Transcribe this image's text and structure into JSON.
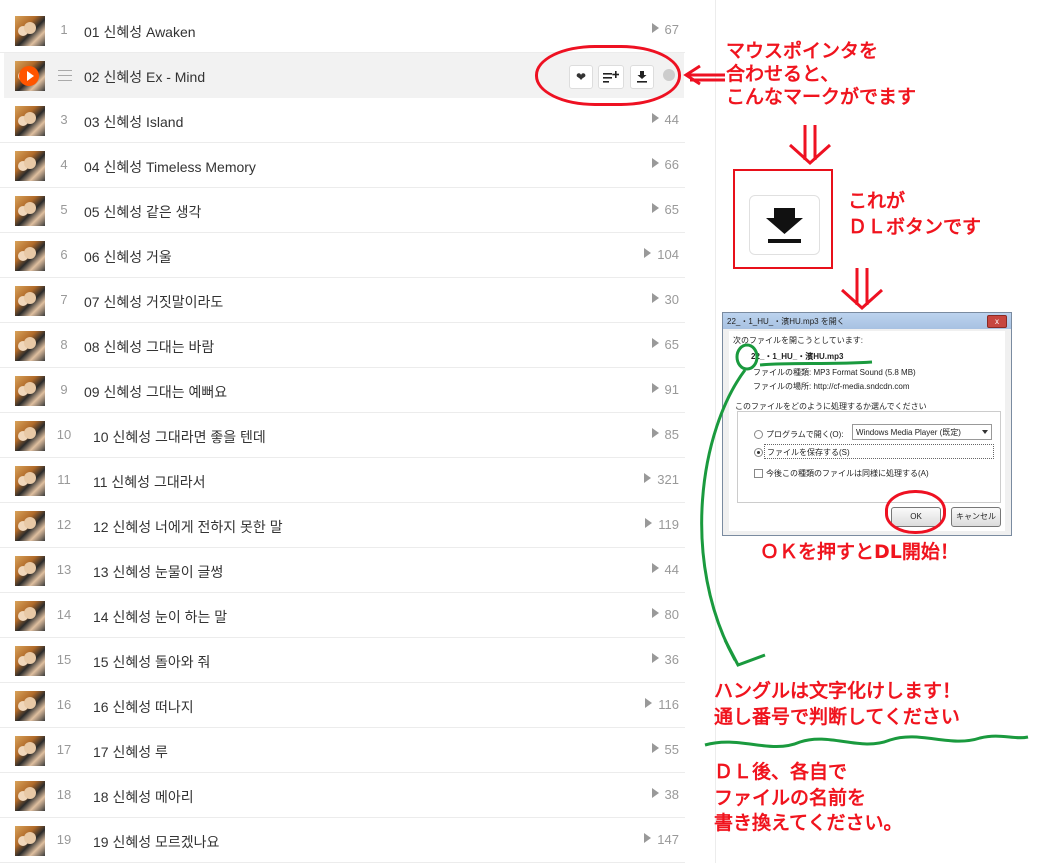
{
  "tracks": [
    {
      "num": "1",
      "title": "01 신혜성 Awaken",
      "plays": "67"
    },
    {
      "num": "",
      "title": "02 신혜성 Ex - Mind",
      "plays": ""
    },
    {
      "num": "3",
      "title": "03 신혜성 Island",
      "plays": "44"
    },
    {
      "num": "4",
      "title": "04 신혜성 Timeless Memory",
      "plays": "66"
    },
    {
      "num": "5",
      "title": "05 신혜성 같은 생각",
      "plays": "65"
    },
    {
      "num": "6",
      "title": "06 신혜성 거울",
      "plays": "104"
    },
    {
      "num": "7",
      "title": "07 신혜성 거짓말이라도",
      "plays": "30"
    },
    {
      "num": "8",
      "title": "08 신혜성 그대는 바람",
      "plays": "65"
    },
    {
      "num": "9",
      "title": "09 신혜성 그대는 예뻐요",
      "plays": "91"
    },
    {
      "num": "10",
      "title": "10 신혜성 그대라면 좋을 텐데",
      "plays": "85"
    },
    {
      "num": "11",
      "title": "11 신혜성 그대라서",
      "plays": "321"
    },
    {
      "num": "12",
      "title": "12 신혜성 너에게 전하지 못한 말",
      "plays": "119"
    },
    {
      "num": "13",
      "title": "13 신혜성 눈물이 글썽",
      "plays": "44"
    },
    {
      "num": "14",
      "title": "14 신혜성 눈이 하는 말",
      "plays": "80"
    },
    {
      "num": "15",
      "title": "15 신혜성 돌아와 줘",
      "plays": "36"
    },
    {
      "num": "16",
      "title": "16 신혜성 떠나지",
      "plays": "116"
    },
    {
      "num": "17",
      "title": "17 신혜성 루",
      "plays": "55"
    },
    {
      "num": "18",
      "title": "18 신혜성 메아리",
      "plays": "38"
    },
    {
      "num": "19",
      "title": "19 신혜성 모르겠나요",
      "plays": "147"
    }
  ],
  "hovered_index": 1,
  "icons": {
    "like": "heart-icon",
    "add_to_playlist": "playlist-add-icon",
    "download": "download-icon",
    "play": "play-icon",
    "drag": "drag-handle-icon"
  },
  "annotations": {
    "hover_note": [
      "マウスポインタを",
      "合わせると、",
      "こんなマークがでます"
    ],
    "dl_button_note": [
      "これが",
      "ＤＬボタンです"
    ],
    "ok_note": "ＯＫを押すとDL開始！",
    "hangul_note": [
      "ハングルは文字化けします！",
      "通し番号で判断してください"
    ],
    "rename_note": [
      "ＤＬ後、各自で",
      "ファイルの名前を",
      "書き換えてください。"
    ]
  },
  "dialog": {
    "title": "22_・1_HU_・濱HU.mp3 を開く",
    "opening_label": "次のファイルを開こうとしています:",
    "filename": "22_・1_HU_・濱HU.mp3",
    "type_label": "ファイルの種類: MP3 Format Sound (5.8 MB)",
    "location_label": "ファイルの場所: http://cf-media.sndcdn.com",
    "question": "このファイルをどのように処理するか選んでください",
    "open_with_label": "プログラムで開く(O):",
    "open_with_value": "Windows Media Player (既定)",
    "save_label": "ファイルを保存する(S)",
    "remember_label": "今後この種類のファイルは同様に処理する(A)",
    "ok": "OK",
    "cancel": "キャンセル",
    "close": "x"
  },
  "colors": {
    "accent": "#ff5500",
    "annotation_red": "#f0141e",
    "annotation_green": "#1a9a3e"
  }
}
